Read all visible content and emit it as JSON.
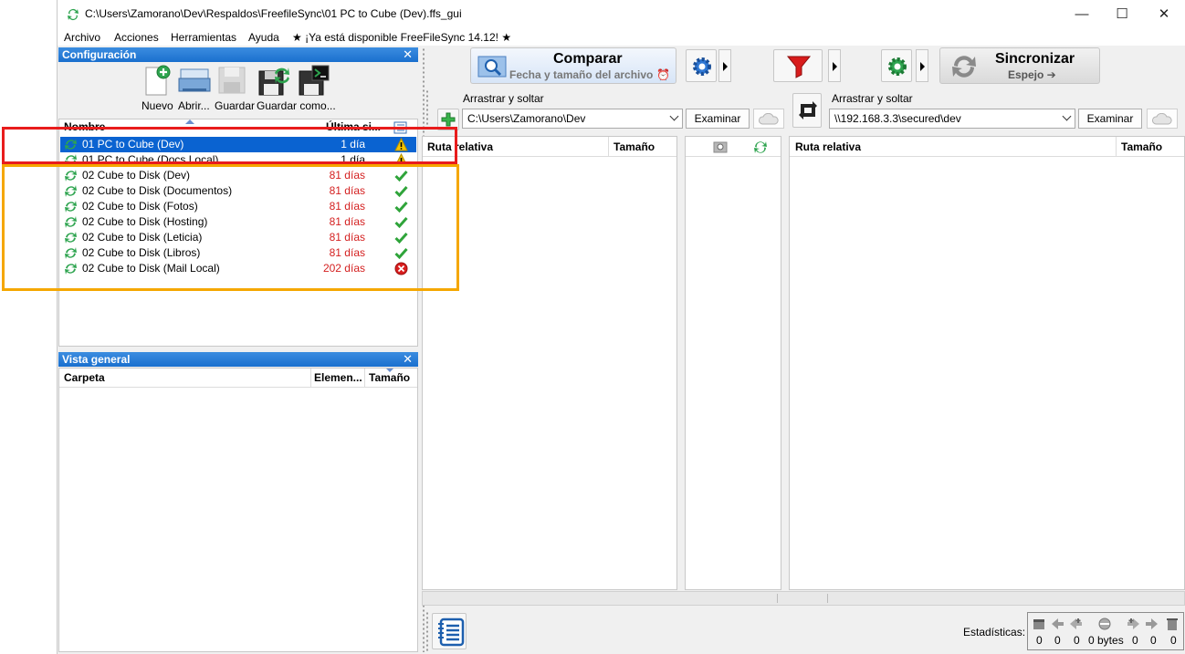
{
  "window": {
    "title": "C:\\Users\\Zamorano\\Dev\\Respaldos\\FreefileSync\\01 PC to Cube (Dev).ffs_gui",
    "controls": [
      "—",
      "☐",
      "✕"
    ]
  },
  "menu": {
    "items": [
      "Archivo",
      "Acciones",
      "Herramientas",
      "Ayuda"
    ],
    "update_notice": "★ ¡Ya está disponible FreeFileSync 14.12! ★"
  },
  "config_panel": {
    "title": "Configuración",
    "close": "✕",
    "toolbar": {
      "new_label": "Nuevo",
      "open_label": "Abrir...",
      "save_label": "Guardar",
      "save_as_label": "Guardar como..."
    },
    "columns": {
      "name": "Nombre",
      "last_sync": "Última si..."
    },
    "rows": [
      {
        "name": "01 PC to Cube (Dev)",
        "days": "1 día",
        "status": "warning",
        "selected": true,
        "days_color": "#ffffff"
      },
      {
        "name": "01 PC to Cube (Docs Local)",
        "days": "1 día",
        "status": "warning",
        "selected": false,
        "days_color": "#000000"
      },
      {
        "name": "02 Cube to Disk (Dev)",
        "days": "81 días",
        "status": "ok",
        "selected": false,
        "days_color": "#d42020"
      },
      {
        "name": "02 Cube to Disk (Documentos)",
        "days": "81 días",
        "status": "ok",
        "selected": false,
        "days_color": "#d42020"
      },
      {
        "name": "02 Cube to Disk (Fotos)",
        "days": "81 días",
        "status": "ok",
        "selected": false,
        "days_color": "#d42020"
      },
      {
        "name": "02 Cube to Disk (Hosting)",
        "days": "81 días",
        "status": "ok",
        "selected": false,
        "days_color": "#d42020"
      },
      {
        "name": "02 Cube to Disk (Leticia)",
        "days": "81 días",
        "status": "ok",
        "selected": false,
        "days_color": "#d42020"
      },
      {
        "name": "02 Cube to Disk (Libros)",
        "days": "81 días",
        "status": "ok",
        "selected": false,
        "days_color": "#d42020"
      },
      {
        "name": "02 Cube to Disk (Mail Local)",
        "days": "202 días",
        "status": "error",
        "selected": false,
        "days_color": "#d42020"
      }
    ]
  },
  "overview_panel": {
    "title": "Vista general",
    "close": "✕",
    "columns": {
      "folder": "Carpeta",
      "items": "Elemen...",
      "size": "Tamaño"
    }
  },
  "main_toolbar": {
    "compare_label": "Comparar",
    "compare_sub": "Fecha y tamaño del archivo",
    "sync_label": "Sincronizar",
    "sync_sub": "Espejo ➔"
  },
  "left_folder": {
    "drag_label": "Arrastrar y soltar",
    "path": "C:\\Users\\Zamorano\\Dev",
    "browse_label": "Examinar"
  },
  "right_folder": {
    "drag_label": "Arrastrar y soltar",
    "path": "\\\\192.168.3.3\\secured\\dev",
    "browse_label": "Examinar"
  },
  "grid": {
    "left_columns": {
      "relpath": "Ruta relativa",
      "size": "Tamaño"
    },
    "right_columns": {
      "relpath": "Ruta relativa",
      "size": "Tamaño"
    }
  },
  "status_bar": {
    "stats_label": "Estadísticas:",
    "counts": [
      "0",
      "0",
      "0",
      "0 bytes",
      "0",
      "0",
      "0"
    ]
  },
  "colors": {
    "selection": "#0a63d1",
    "panel_header": "#1a6fce",
    "overdue_text": "#d42020",
    "highlight_red": "#e81c1c",
    "highlight_orange": "#f5a700"
  }
}
